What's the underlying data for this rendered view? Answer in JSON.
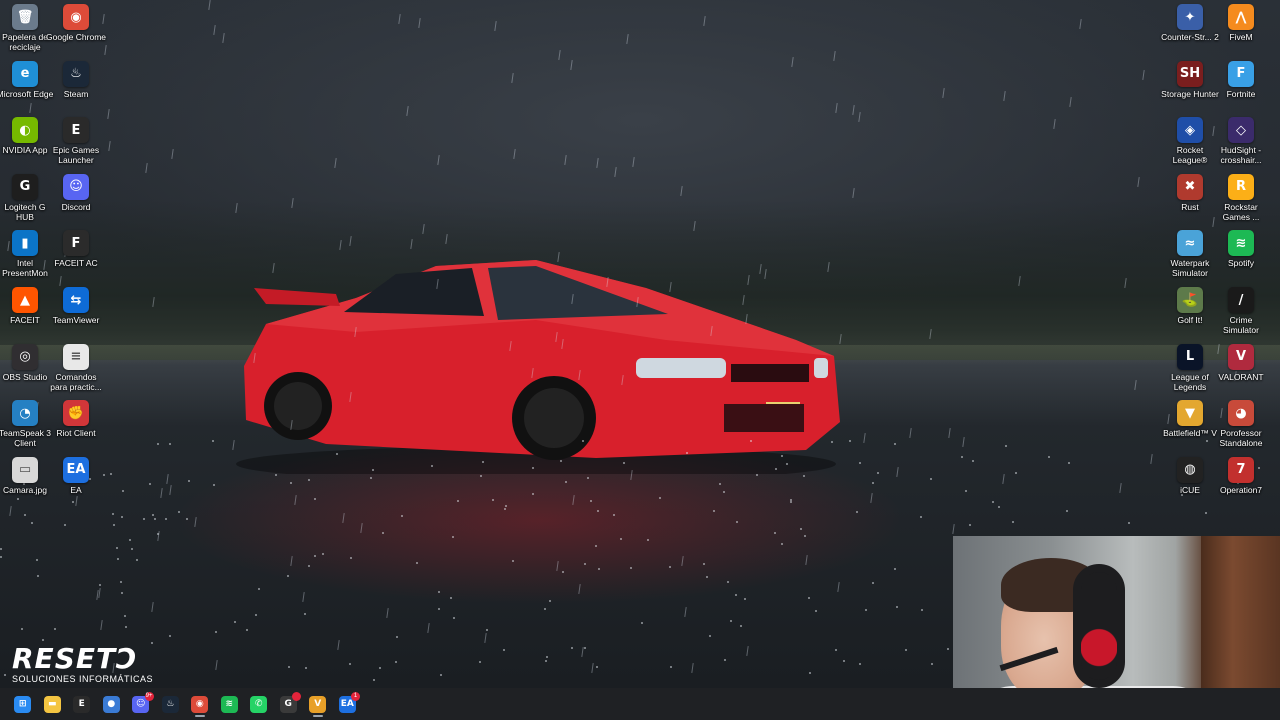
{
  "desktop_icons_left": [
    {
      "label": "Papelera de reciclaje",
      "icon": "recycle-bin-icon",
      "color": "#6b7b8c",
      "glyph": "🗑",
      "col": 0,
      "row": 0
    },
    {
      "label": "Google Chrome",
      "icon": "chrome-icon",
      "color": "#dd4b39",
      "glyph": "◉",
      "col": 1,
      "row": 0
    },
    {
      "label": "Microsoft Edge",
      "icon": "edge-icon",
      "color": "#1f8fd6",
      "glyph": "e",
      "col": 0,
      "row": 1
    },
    {
      "label": "Steam",
      "icon": "steam-icon",
      "color": "#1b2838",
      "glyph": "♨",
      "col": 1,
      "row": 1
    },
    {
      "label": "NVIDIA App",
      "icon": "nvidia-icon",
      "color": "#76b900",
      "glyph": "◐",
      "col": 0,
      "row": 2
    },
    {
      "label": "Epic Games Launcher",
      "icon": "epic-games-icon",
      "color": "#2a2a2a",
      "glyph": "E",
      "col": 1,
      "row": 2
    },
    {
      "label": "Logitech G HUB",
      "icon": "logitech-icon",
      "color": "#1e1e1e",
      "glyph": "G",
      "col": 0,
      "row": 3
    },
    {
      "label": "Discord",
      "icon": "discord-icon",
      "color": "#5865f2",
      "glyph": "☺",
      "col": 1,
      "row": 3
    },
    {
      "label": "Intel PresentMon",
      "icon": "presentmon-icon",
      "color": "#0b74c7",
      "glyph": "▮",
      "col": 0,
      "row": 4
    },
    {
      "label": "FACEIT AC",
      "icon": "faceit-ac-icon",
      "color": "#2b2b2b",
      "glyph": "F",
      "col": 1,
      "row": 4
    },
    {
      "label": "FACEIT",
      "icon": "faceit-icon",
      "color": "#ff5500",
      "glyph": "▲",
      "col": 0,
      "row": 5
    },
    {
      "label": "TeamViewer",
      "icon": "teamviewer-icon",
      "color": "#0e6bd6",
      "glyph": "⇆",
      "col": 1,
      "row": 5
    },
    {
      "label": "OBS Studio",
      "icon": "obs-icon",
      "color": "#302e31",
      "glyph": "◎",
      "col": 0,
      "row": 6
    },
    {
      "label": "Comandos para practic...",
      "icon": "text-file-icon",
      "color": "#e8e8e8",
      "glyph": "≡",
      "col": 1,
      "row": 6
    },
    {
      "label": "TeamSpeak 3 Client",
      "icon": "teamspeak-icon",
      "color": "#2580c3",
      "glyph": "◔",
      "col": 0,
      "row": 7
    },
    {
      "label": "Riot Client",
      "icon": "riot-icon",
      "color": "#d13639",
      "glyph": "✊",
      "col": 1,
      "row": 7
    },
    {
      "label": "Camara.jpg",
      "icon": "image-file-icon",
      "color": "#d8d8d8",
      "glyph": "▭",
      "col": 0,
      "row": 8
    },
    {
      "label": "EA",
      "icon": "ea-icon",
      "color": "#1d6fe0",
      "glyph": "EA",
      "col": 1,
      "row": 8
    }
  ],
  "desktop_icons_right": [
    {
      "label": "Counter-Str... 2",
      "icon": "counter-strike-icon",
      "color": "#3a5fa8",
      "glyph": "✦",
      "col": 0,
      "row": 0
    },
    {
      "label": "FiveM",
      "icon": "fivem-icon",
      "color": "#f58b1e",
      "glyph": "⋀",
      "col": 1,
      "row": 0
    },
    {
      "label": "Storage Hunter",
      "icon": "storage-hunter-icon",
      "color": "#7a1e1e",
      "glyph": "SH",
      "col": 0,
      "row": 1
    },
    {
      "label": "Fortnite",
      "icon": "fortnite-icon",
      "color": "#39a0e6",
      "glyph": "F",
      "col": 1,
      "row": 1
    },
    {
      "label": "Rocket League®",
      "icon": "rocket-league-icon",
      "color": "#1f4ea8",
      "glyph": "◈",
      "col": 0,
      "row": 2
    },
    {
      "label": "HudSight - crosshair...",
      "icon": "hudsight-icon",
      "color": "#3b2b6b",
      "glyph": "◇",
      "col": 1,
      "row": 2
    },
    {
      "label": "Rust",
      "icon": "rust-icon",
      "color": "#b03a2e",
      "glyph": "✖",
      "col": 0,
      "row": 3
    },
    {
      "label": "Rockstar Games ...",
      "icon": "rockstar-icon",
      "color": "#fcaf17",
      "glyph": "R",
      "col": 1,
      "row": 3
    },
    {
      "label": "Waterpark Simulator",
      "icon": "waterpark-icon",
      "color": "#4aa3d8",
      "glyph": "≈",
      "col": 0,
      "row": 4
    },
    {
      "label": "Spotify",
      "icon": "spotify-icon",
      "color": "#1db954",
      "glyph": "≋",
      "col": 1,
      "row": 4
    },
    {
      "label": "Golf It!",
      "icon": "golf-it-icon",
      "color": "#5d7a4a",
      "glyph": "⛳",
      "col": 0,
      "row": 5
    },
    {
      "label": "Crime Simulator",
      "icon": "crime-simulator-icon",
      "color": "#1a1a1a",
      "glyph": "/",
      "col": 1,
      "row": 5
    },
    {
      "label": "League of Legends",
      "icon": "league-icon",
      "color": "#0a1428",
      "glyph": "L",
      "col": 0,
      "row": 6
    },
    {
      "label": "VALORANT",
      "icon": "valorant-icon",
      "color": "#b02a3e",
      "glyph": "V",
      "col": 1,
      "row": 6
    },
    {
      "label": "Battlefield™ V",
      "icon": "battlefield-icon",
      "color": "#e3a72f",
      "glyph": "▼",
      "col": 0,
      "row": 7
    },
    {
      "label": "Porofessor Standalone",
      "icon": "porofessor-icon",
      "color": "#c84a3a",
      "glyph": "◕",
      "col": 1,
      "row": 7
    },
    {
      "label": "iCUE",
      "icon": "icue-icon",
      "color": "#222222",
      "glyph": "◍",
      "col": 0,
      "row": 8
    },
    {
      "label": "Operation7",
      "icon": "operation7-icon",
      "color": "#c2302e",
      "glyph": "7",
      "col": 1,
      "row": 8
    }
  ],
  "logo": {
    "main": "RESETↃ",
    "sub": "SOLUCIONES INFORMÁTICAS"
  },
  "taskbar": [
    {
      "name": "start-button",
      "icon": "windows-start-icon",
      "color": "#2a8bf2",
      "glyph": "⊞"
    },
    {
      "name": "file-explorer-button",
      "icon": "folder-icon",
      "color": "#f4c542",
      "glyph": "▬"
    },
    {
      "name": "epic-games-button",
      "icon": "epic-games-icon",
      "color": "#2a2a2a",
      "glyph": "E"
    },
    {
      "name": "app-drop-button",
      "icon": "drop-icon",
      "color": "#3a7bd5",
      "glyph": "●"
    },
    {
      "name": "discord-button",
      "icon": "discord-icon",
      "color": "#5865f2",
      "glyph": "☺",
      "badge": "9+"
    },
    {
      "name": "steam-button",
      "icon": "steam-icon",
      "color": "#1b2838",
      "glyph": "♨"
    },
    {
      "name": "chrome-button",
      "icon": "chrome-icon",
      "color": "#dd4b39",
      "glyph": "◉",
      "active": true
    },
    {
      "name": "spotify-button",
      "icon": "spotify-icon",
      "color": "#1db954",
      "glyph": "≋"
    },
    {
      "name": "whatsapp-button",
      "icon": "whatsapp-icon",
      "color": "#25d366",
      "glyph": "✆"
    },
    {
      "name": "logitech-button",
      "icon": "logitech-icon",
      "color": "#3a3a3a",
      "glyph": "G",
      "badge": ""
    },
    {
      "name": "video-editor-button",
      "icon": "video-editor-icon",
      "color": "#e8a028",
      "glyph": "V",
      "active": true
    },
    {
      "name": "ea-button",
      "icon": "ea-icon",
      "color": "#1d6fe0",
      "glyph": "EA",
      "badge": "1"
    }
  ]
}
